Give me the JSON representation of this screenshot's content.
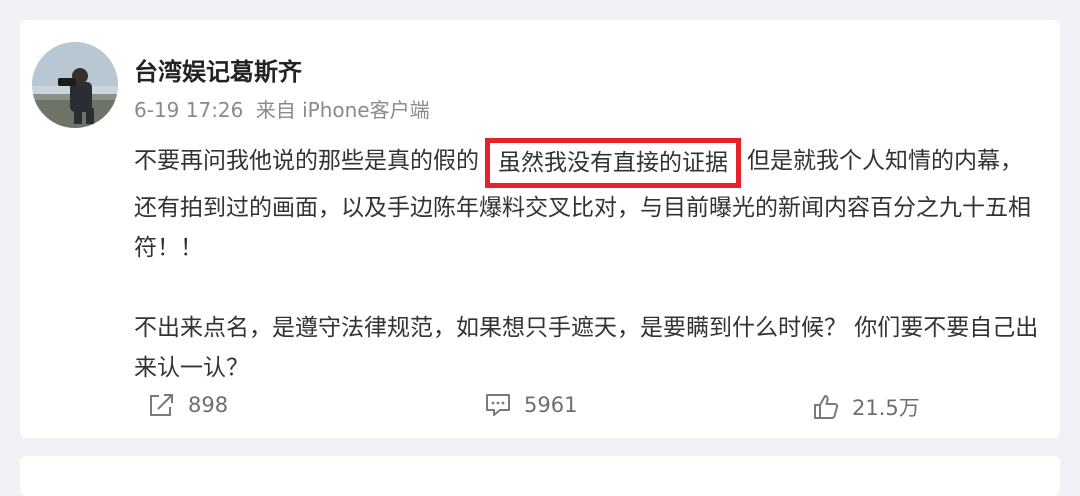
{
  "post": {
    "username": "台湾娱记葛斯齐",
    "time": "6-19 17:26",
    "source": "来自 iPhone客户端",
    "text_before": "不要再问我他说的那些是真的假的",
    "text_highlight": "虽然我没有直接的证据",
    "text_after": "但是就我个人知情的内幕，还有拍到过的画面，以及手边陈年爆料交叉比对，与目前曝光的新闻内容百分之九十五相符！！",
    "paragraph2": "不出来点名，是遵守法律规范，如果想只手遮天，是要瞒到什么时候？ 你们要不要自己出来认一认？",
    "highlight_color": "#e8222a"
  },
  "actions": {
    "repost": {
      "icon": "share-icon",
      "count": "898"
    },
    "comment": {
      "icon": "comment-icon",
      "count": "5961"
    },
    "like": {
      "icon": "thumbs-up-icon",
      "count": "21.5万"
    }
  }
}
